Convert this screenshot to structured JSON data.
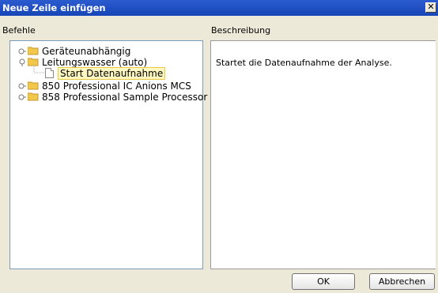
{
  "window": {
    "title": "Neue Zeile einfügen",
    "close_glyph": "✕"
  },
  "left": {
    "label": "Befehle"
  },
  "right": {
    "label": "Beschreibung",
    "description": "Startet die Datenaufnahme der Analyse."
  },
  "tree": {
    "items": [
      {
        "label": "Geräteunabhängig",
        "icon": "folder-icon",
        "toggle": "expand"
      },
      {
        "label": "Leitungswasser (auto)",
        "icon": "folder-icon",
        "toggle": "collapse",
        "children": [
          {
            "label": "Start Datenaufnahme",
            "icon": "document-icon",
            "selected": true
          }
        ]
      },
      {
        "label": "850 Professional IC Anions MCS",
        "icon": "folder-icon",
        "toggle": "expand"
      },
      {
        "label": "858 Professional Sample Processor",
        "icon": "folder-icon",
        "toggle": "expand"
      }
    ]
  },
  "buttons": {
    "ok": "OK",
    "cancel": "Abbrechen"
  },
  "colors": {
    "titlebar": "#1745b8",
    "folder": "#f2c84b",
    "selection": "#fff8c0"
  }
}
